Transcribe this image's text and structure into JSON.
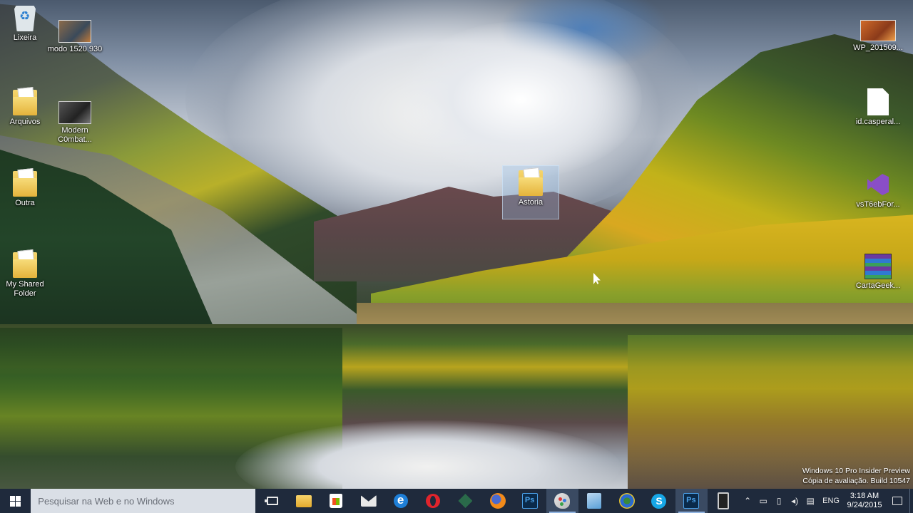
{
  "desktop_icons_left": [
    {
      "label": "Lixeira",
      "icon": "recycle-bin-icon"
    },
    {
      "label": "modo 1520 930",
      "icon": "image-thumbnail-icon"
    },
    {
      "label": "Arquivos",
      "icon": "folder-icon"
    },
    {
      "label": "Modern C0mbat...",
      "icon": "game-shortcut-icon"
    },
    {
      "label": "Outra",
      "icon": "folder-icon"
    },
    {
      "label": "My Shared Folder",
      "icon": "shared-folder-icon"
    }
  ],
  "desktop_icons_right": [
    {
      "label": "WP_201509...",
      "icon": "image-thumbnail-icon"
    },
    {
      "label": "id.casperal...",
      "icon": "file-icon"
    },
    {
      "label": "vsT6ebFor...",
      "icon": "visual-studio-icon"
    },
    {
      "label": "CartaGeek...",
      "icon": "winrar-archive-icon"
    }
  ],
  "dragged_icon": {
    "label": "Astoria",
    "icon": "folder-icon"
  },
  "watermark": {
    "line1": "Windows 10 Pro Insider Preview",
    "line2": "Cópia de avaliação. Build 10547"
  },
  "taskbar": {
    "search_placeholder": "Pesquisar na Web e no Windows",
    "apps": [
      {
        "name": "file-explorer",
        "icon": "folder-icon",
        "active": false
      },
      {
        "name": "store",
        "icon": "store-icon",
        "active": false
      },
      {
        "name": "mail",
        "icon": "mail-icon",
        "active": false
      },
      {
        "name": "edge",
        "icon": "edge-icon",
        "active": false
      },
      {
        "name": "opera",
        "icon": "opera-icon",
        "active": false
      },
      {
        "name": "green-app",
        "icon": "diamond-app-icon",
        "active": false
      },
      {
        "name": "firefox",
        "icon": "firefox-icon",
        "active": false
      },
      {
        "name": "photoshop",
        "icon": "photoshop-icon",
        "active": false
      },
      {
        "name": "paint",
        "icon": "paint-icon",
        "active": true
      },
      {
        "name": "blue-doc",
        "icon": "document-icon",
        "active": false
      },
      {
        "name": "globe-app",
        "icon": "globe-icon",
        "active": false
      },
      {
        "name": "skype",
        "icon": "skype-icon",
        "active": false
      },
      {
        "name": "photoshop-2",
        "icon": "photoshop-icon",
        "active": true
      },
      {
        "name": "phone",
        "icon": "phone-icon",
        "active": false
      }
    ],
    "tray": {
      "language": "ENG",
      "time": "3:18 AM",
      "date": "9/24/2015"
    }
  },
  "colors": {
    "taskbar": "#1f2a3c",
    "search_box": "#dadfe6",
    "accent": "#8fb3e0"
  }
}
